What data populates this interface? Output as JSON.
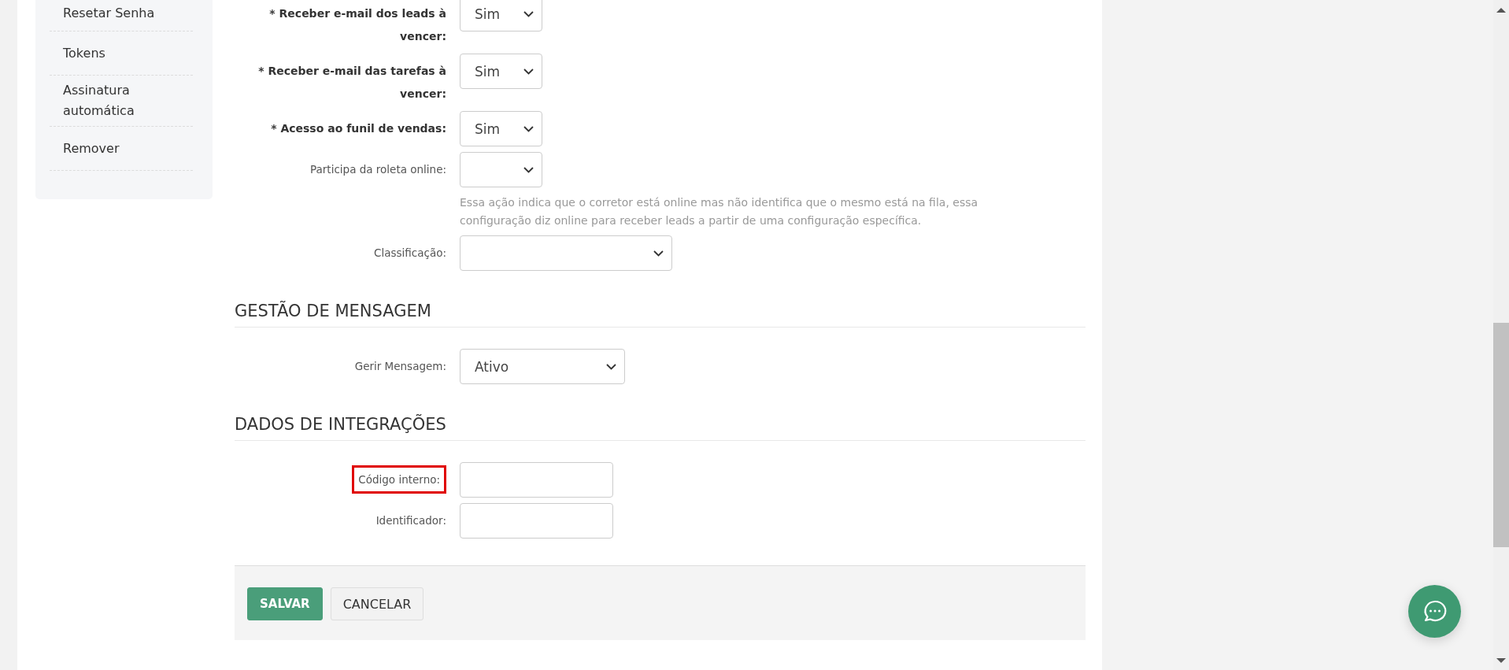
{
  "sidebar": {
    "items": [
      {
        "label": "Resetar Senha"
      },
      {
        "label": "Tokens"
      },
      {
        "label": "Assinatura automática"
      },
      {
        "label": "Remover"
      }
    ]
  },
  "sections": [
    {
      "fields": [
        {
          "label": "* Receber e-mail dos leads à vencer:",
          "required": true,
          "kind": "short",
          "value": "Sim"
        },
        {
          "label": "* Receber e-mail das tarefas à vencer:",
          "required": true,
          "kind": "short",
          "value": "Sim"
        },
        {
          "label": "* Acesso ao funil de vendas:",
          "required": true,
          "kind": "short",
          "value": "Sim"
        },
        {
          "label": "Participa da roleta online:",
          "required": false,
          "kind": "short",
          "help": "Essa ação indica que o corretor está online mas não identifica que o mesmo está na fila, essa configuração diz online para receber leads a partir de uma configuração específica."
        },
        {
          "label": "Classificação:",
          "required": false,
          "kind": "wide"
        }
      ]
    },
    {
      "title": "GESTÃO DE MENSAGEM",
      "fields": [
        {
          "label": "Gerir Mensagem:",
          "required": false,
          "kind": "medium",
          "value": "Ativo"
        }
      ]
    },
    {
      "title": "DADOS DE INTEGRAÇÕES",
      "fields": [
        {
          "label": "Código interno:",
          "required": false,
          "kind": "input",
          "highlighted": true
        },
        {
          "label": "Identificador:",
          "required": false,
          "kind": "input",
          "highlighted": false
        }
      ]
    }
  ],
  "actions": [
    {
      "label": "SALVAR",
      "kind": "primary"
    },
    {
      "label": "CANCELAR",
      "kind": "secondary"
    }
  ]
}
